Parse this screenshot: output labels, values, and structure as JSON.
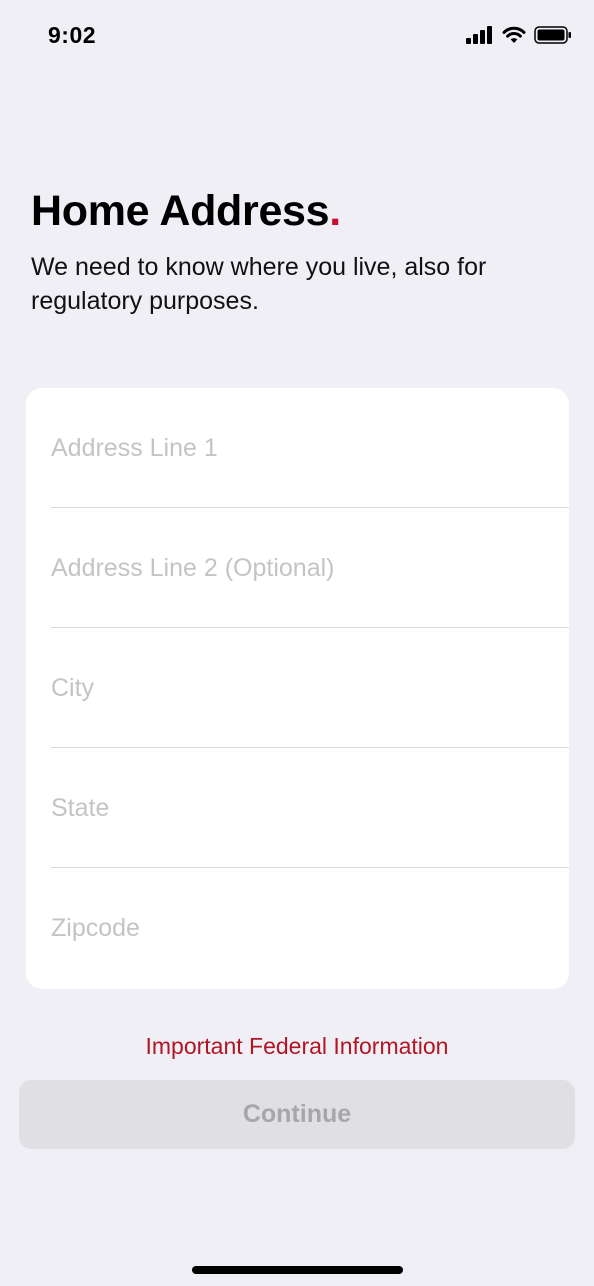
{
  "status_bar": {
    "time": "9:02",
    "icons": [
      "cellular-signal-icon",
      "wifi-icon",
      "battery-icon"
    ]
  },
  "header": {
    "title": "Home Address",
    "title_accent": ".",
    "subtitle": "We need to know where you live, also for regulatory purposes."
  },
  "form": {
    "fields": [
      {
        "placeholder": "Address Line 1",
        "value": ""
      },
      {
        "placeholder": "Address Line 2 (Optional)",
        "value": ""
      },
      {
        "placeholder": "City",
        "value": ""
      },
      {
        "placeholder": "State",
        "value": ""
      },
      {
        "placeholder": "Zipcode",
        "value": ""
      }
    ]
  },
  "footer": {
    "federal_link": "Important Federal Information",
    "continue_label": "Continue"
  },
  "colors": {
    "background": "#f0eff5",
    "accent_red": "#c8102e",
    "link_red": "#b11624",
    "button_disabled_bg": "#dfdfe4",
    "button_disabled_text": "#a6a6ab",
    "placeholder": "#c4c4c7"
  }
}
